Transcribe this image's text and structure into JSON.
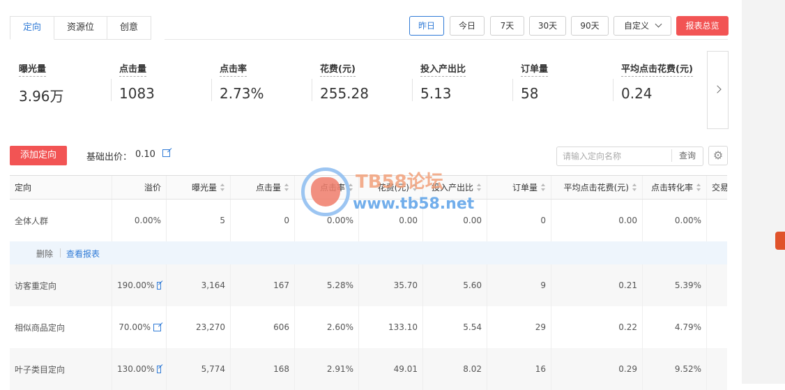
{
  "tabs": [
    "定向",
    "资源位",
    "创意"
  ],
  "date_buttons": [
    "昨日",
    "今日",
    "7天",
    "30天",
    "90天"
  ],
  "custom_label": "自定义",
  "report_button": "报表总览",
  "metrics": [
    {
      "label": "曝光量",
      "value": "3.96万"
    },
    {
      "label": "点击量",
      "value": "1083"
    },
    {
      "label": "点击率",
      "value": "2.73%"
    },
    {
      "label": "花费(元)",
      "value": "255.28"
    },
    {
      "label": "投入产出比",
      "value": "5.13"
    },
    {
      "label": "订单量",
      "value": "58"
    },
    {
      "label": "平均点击花费(元)",
      "value": "0.24"
    }
  ],
  "toolbar": {
    "add_button": "添加定向",
    "base_bid_label": "基础出价：",
    "base_bid_value": "0.10",
    "search_placeholder": "请输入定向名称",
    "search_button": "查询"
  },
  "table": {
    "headers": [
      "定向",
      "溢价",
      "曝光量",
      "点击量",
      "点击率",
      "花费(元)",
      "投入产出比",
      "订单量",
      "平均点击花费(元)",
      "点击转化率",
      "交易"
    ],
    "rows": [
      {
        "name": "全体人群",
        "premium": "0.00%",
        "impressions": "5",
        "clicks": "0",
        "ctr": "0.00%",
        "cost": "0.00",
        "roi": "0.00",
        "orders": "0",
        "cpc": "0.00",
        "cvr": "0.00%"
      },
      {
        "name": "访客重定向",
        "premium": "190.00%",
        "impressions": "3,164",
        "clicks": "167",
        "ctr": "5.28%",
        "cost": "35.70",
        "roi": "5.60",
        "orders": "9",
        "cpc": "0.21",
        "cvr": "5.39%"
      },
      {
        "name": "相似商品定向",
        "premium": "70.00%",
        "impressions": "23,270",
        "clicks": "606",
        "ctr": "2.60%",
        "cost": "133.10",
        "roi": "5.54",
        "orders": "29",
        "cpc": "0.22",
        "cvr": "4.79%"
      },
      {
        "name": "叶子类目定向",
        "premium": "130.00%",
        "impressions": "5,774",
        "clicks": "168",
        "ctr": "2.91%",
        "cost": "49.01",
        "roi": "8.02",
        "orders": "16",
        "cpc": "0.29",
        "cvr": "9.52%"
      }
    ],
    "sub_actions": {
      "delete": "删除",
      "view_report": "查看报表"
    }
  },
  "watermark": {
    "title": "TB58论坛",
    "url": "www.tb58.net"
  },
  "colors": {
    "accent": "#2f7ad6",
    "red": "#f25454",
    "link": "#2f7ad6"
  }
}
